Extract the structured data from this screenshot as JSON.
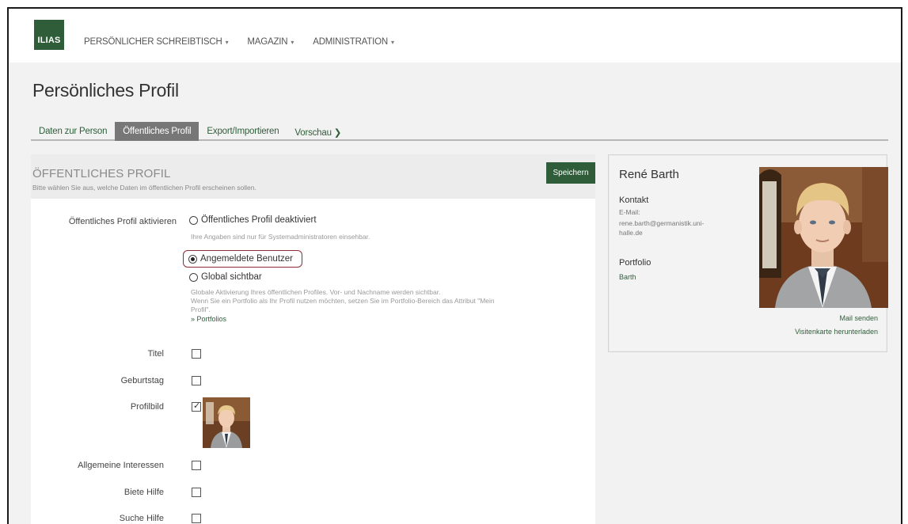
{
  "app": {
    "logo_text": "ILIAS"
  },
  "nav": {
    "items": [
      {
        "label": "PERSÖNLICHER SCHREIBTISCH"
      },
      {
        "label": "MAGAZIN"
      },
      {
        "label": "ADMINISTRATION"
      }
    ],
    "caret": "▾"
  },
  "page": {
    "title": "Persönliches Profil"
  },
  "tabs": [
    {
      "label": "Daten zur Person",
      "active": false
    },
    {
      "label": "Öffentliches Profil",
      "active": true
    },
    {
      "label": "Export/Importieren",
      "active": false
    },
    {
      "label": "Vorschau",
      "active": false
    }
  ],
  "form": {
    "title": "ÖFFENTLICHES PROFIL",
    "subtitle": "Bitte wählen Sie aus, welche Daten im öffentlichen Profil erscheinen sollen.",
    "save_label": "Speichern",
    "activate_label": "Öffentliches Profil aktivieren",
    "options": [
      {
        "label": "Öffentliches Profil deaktiviert",
        "checked": false,
        "hint": "Ihre Angaben sind nur für Systemadministratoren einsehbar."
      },
      {
        "label": "Angemeldete Benutzer",
        "checked": true
      },
      {
        "label": "Global sichtbar",
        "checked": false
      }
    ],
    "global_hint_1": "Globale Aktivierung Ihres öffentlichen Profiles. Vor- und Nachname werden sichtbar.",
    "global_hint_2": "Wenn Sie ein Portfolio als Ihr Profil nutzen möchten, setzen Sie im Portfolio-Bereich das Attribut \"Mein",
    "global_hint_3": "Profil\".",
    "portfolios_link": "» Portfolios",
    "fields": [
      {
        "label": "Titel",
        "checked": false
      },
      {
        "label": "Geburtstag",
        "checked": false
      },
      {
        "label": "Profilbild",
        "checked": true
      },
      {
        "label": "Allgemeine Interessen",
        "checked": false
      },
      {
        "label": "Biete Hilfe",
        "checked": false
      },
      {
        "label": "Suche Hilfe",
        "checked": false
      }
    ]
  },
  "card": {
    "name": "René Barth",
    "contact_label": "Kontakt",
    "email_label": "E-Mail:",
    "email_line1": "rene.barth@germanistik.uni-",
    "email_line2": "halle.de",
    "portfolio_label": "Portfolio",
    "portfolio_value": "Barth",
    "mail_link": "Mail senden",
    "vcard_link": "Visitenkarte herunterladen"
  },
  "colors": {
    "brand": "#2f5d3a",
    "highlight": "#8b2d36"
  }
}
